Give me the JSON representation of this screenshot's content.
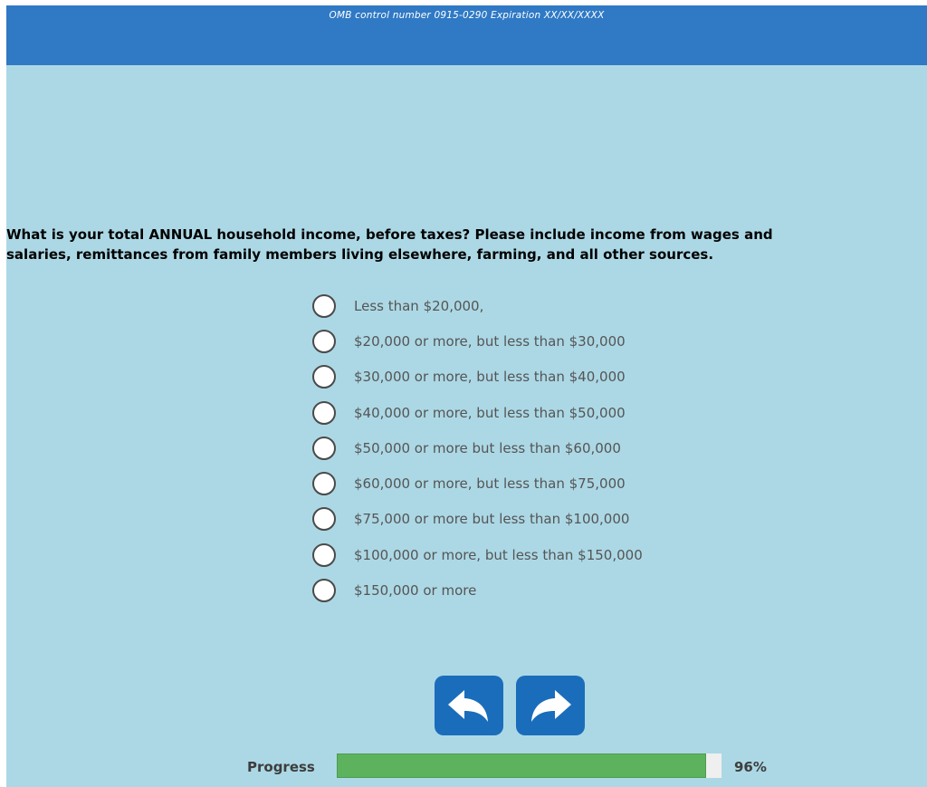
{
  "header": {
    "omb_text": "OMB control number 0915-0290 Expiration XX/XX/XXXX",
    "color": "#2f79c5"
  },
  "question": {
    "line1": "What is your total ANNUAL household income, before taxes? Please include income from wages and",
    "line2": "salaries, remittances from family members living elsewhere, farming, and all other sources."
  },
  "options": [
    {
      "label": "Less than $20,000,",
      "selected": false
    },
    {
      "label": "$20,000 or more, but less than $30,000",
      "selected": false
    },
    {
      "label": "$30,000 or more, but less than $40,000",
      "selected": false
    },
    {
      "label": "$40,000 or more, but less than $50,000",
      "selected": false
    },
    {
      "label": "$50,000 or more but less than $60,000",
      "selected": false
    },
    {
      "label": "$60,000 or more, but less than $75,000",
      "selected": false
    },
    {
      "label": "$75,000 or more but less than $100,000",
      "selected": false
    },
    {
      "label": "$100,000 or more, but less than $150,000",
      "selected": false
    },
    {
      "label": "$150,000 or more",
      "selected": false
    }
  ],
  "navigation": {
    "back_icon": "arrow-back-icon",
    "next_icon": "arrow-forward-icon",
    "button_color": "#1a6dba"
  },
  "progress": {
    "label": "Progress",
    "percent_text": "96%",
    "fraction": 0.96,
    "fill_color": "#5cb25d"
  }
}
